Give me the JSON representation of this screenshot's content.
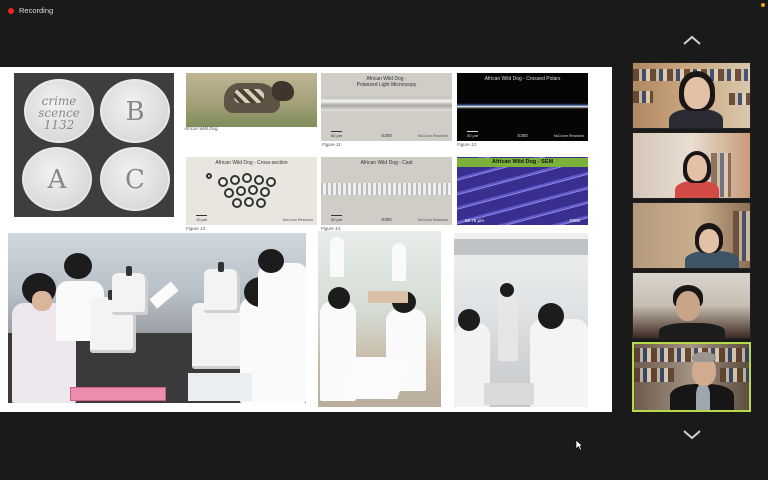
{
  "status": {
    "recording_label": "Recording"
  },
  "slide": {
    "petri_labels": [
      "crime\nscence\n1132",
      "B",
      "A",
      "C"
    ],
    "captions": {
      "dog_photo": "African Wild Dog.",
      "fig11": "Figure 11.",
      "fig12": "Figure 12.",
      "fig13": "Figure 13.",
      "fig14": "Figure 14."
    },
    "micrographs": {
      "polarized": {
        "title": "African Wild Dog -\nPolarized Light Microscopy",
        "scale": "50 μm",
        "mag": "X300",
        "credit": "McCrone Research"
      },
      "crossed": {
        "title": "African Wild Dog - Crossed Polars",
        "scale": "50 μm",
        "mag": "X300",
        "credit": "McCrone Research"
      },
      "cross_section": {
        "title": "African Wild Dog - Cross-section",
        "scale": "10 μm",
        "credit": "McCrone Research"
      },
      "cast": {
        "title": "African Wild Dog - Cast",
        "scale": "50 μm",
        "mag": "X300",
        "credit": "McCrone Research"
      },
      "sem": {
        "title": "African Wild Dog - SEM",
        "scale": "60.76 μm",
        "mag": "X900"
      }
    }
  },
  "navigation": {
    "up_icon": "chevron-up-icon",
    "down_icon": "chevron-down-icon"
  },
  "participants_count": 5,
  "colors": {
    "accent_active": "#b8d94a",
    "recording": "#ee2222",
    "background": "#1a1a1a"
  }
}
